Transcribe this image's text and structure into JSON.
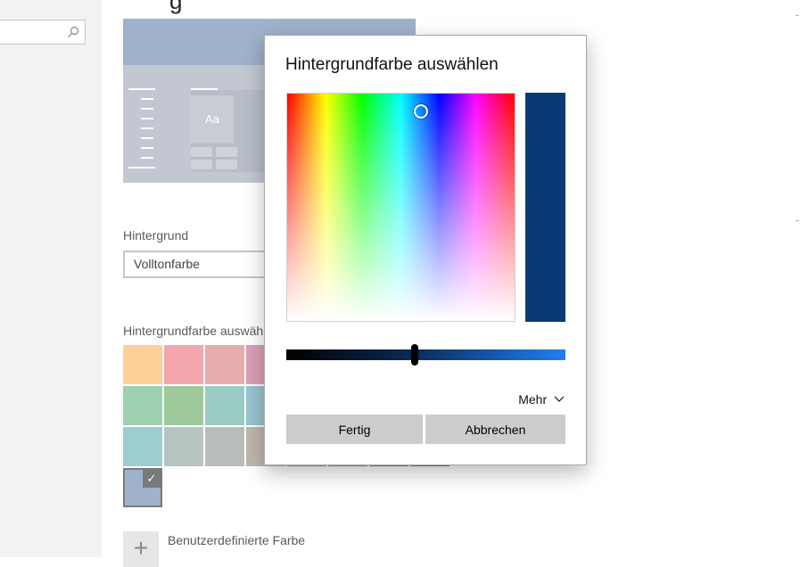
{
  "nav": {
    "search_placeholder": ""
  },
  "page": {
    "title_fragment": "g"
  },
  "preview": {
    "tile_text": "Aa"
  },
  "background_section": {
    "label": "Hintergrund",
    "selected_value": "Volltonfarbe"
  },
  "color_section": {
    "label": "Hintergrundfarbe auswähl",
    "swatches": [
      {
        "color": "#ffcf99"
      },
      {
        "color": "#f3a6ad"
      },
      {
        "color": "#e9acae"
      },
      {
        "color": "#dc9fb6"
      },
      {
        "color": "#ffffff"
      },
      {
        "color": "#ffffff"
      },
      {
        "color": "#ffffff"
      },
      {
        "color": "#ffffff"
      },
      {
        "color": "#9ed1b1"
      },
      {
        "color": "#9dc99b"
      },
      {
        "color": "#9accc6"
      },
      {
        "color": "#98c5d0"
      },
      {
        "color": "#ffffff"
      },
      {
        "color": "#ffffff"
      },
      {
        "color": "#ffffff"
      },
      {
        "color": "#ffffff"
      },
      {
        "color": "#9bcdd1"
      },
      {
        "color": "#b7c4c1"
      },
      {
        "color": "#b9bdba"
      },
      {
        "color": "#c0b6ac"
      },
      {
        "color": "#9a9a9a"
      },
      {
        "color": "#8f8f8f"
      },
      {
        "color": "#858585"
      },
      {
        "color": "#7b7b7b"
      },
      {
        "color": "#9fb2cb",
        "selected": true
      }
    ],
    "check_glyph": "✓",
    "custom_label": "Benutzerdefinierte Farbe",
    "custom_glyph": "+"
  },
  "dialog": {
    "title": "Hintergrundfarbe auswählen",
    "selected_color": "#0a3a75",
    "handle": {
      "hue_fraction": 0.59,
      "saturation_fraction": 0.92
    },
    "value_fraction": 0.46,
    "more_label": "Mehr",
    "ok_label": "Fertig",
    "cancel_label": "Abbrechen"
  },
  "right_edge": {
    "mark_1": "ˉ",
    "mark_2": "ˉ"
  },
  "icons": {
    "search": "search-icon",
    "chevron": "chevron-down-icon",
    "check": "check-icon",
    "add": "plus-icon"
  }
}
